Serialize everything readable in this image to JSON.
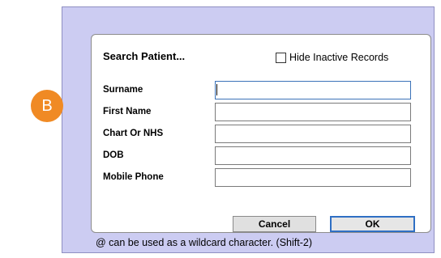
{
  "dialog": {
    "title": "Search Patient...",
    "hide_inactive": {
      "label": "Hide Inactive Records",
      "checked": false
    },
    "fields": [
      {
        "label": "Surname",
        "value": ""
      },
      {
        "label": "First Name",
        "value": ""
      },
      {
        "label": "Chart Or NHS",
        "value": ""
      },
      {
        "label": "DOB",
        "value": ""
      },
      {
        "label": "Mobile Phone",
        "value": ""
      }
    ],
    "cancel_label": "Cancel",
    "ok_label": "OK",
    "footer_hint": "@ can be used as a wildcard character. (Shift-2)"
  },
  "annotation": {
    "marker_label": "B",
    "marker_color": "#f08a24"
  }
}
